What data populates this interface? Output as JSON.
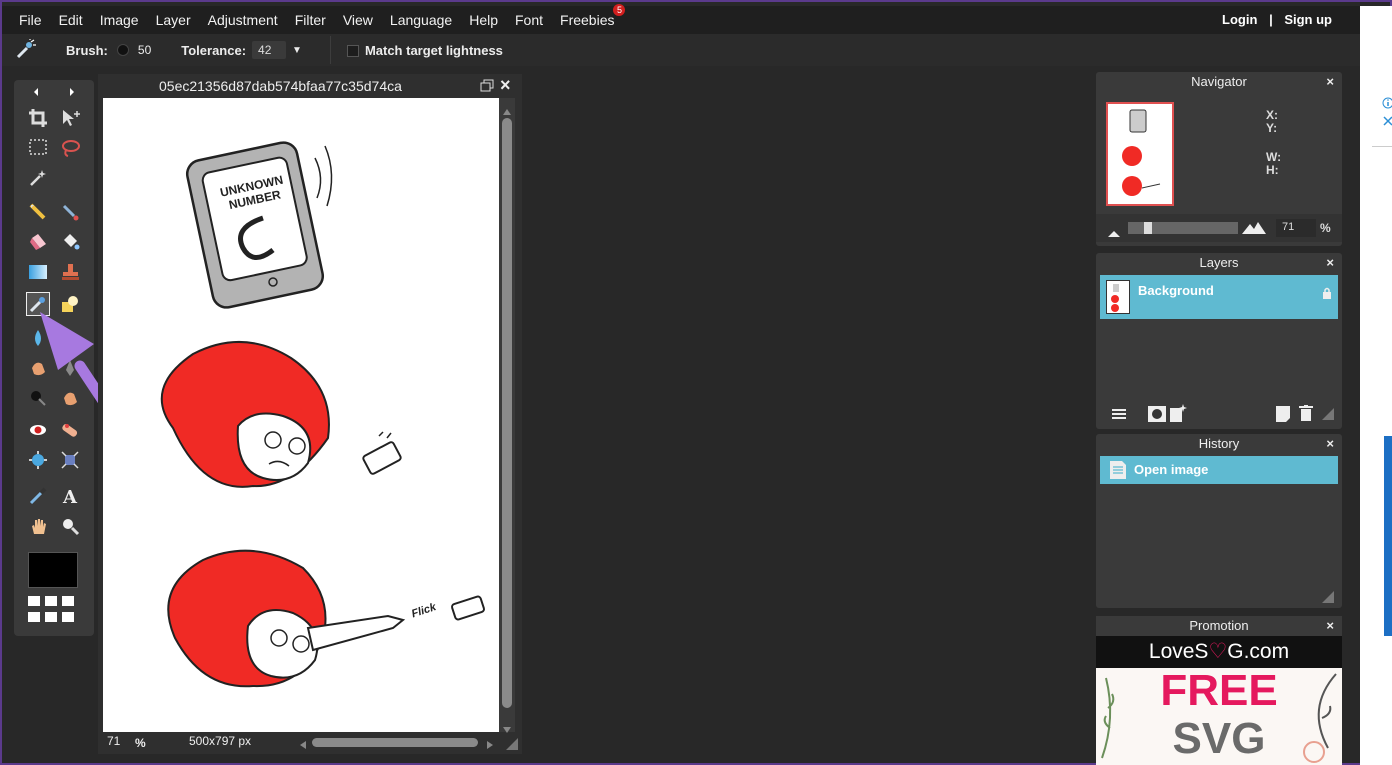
{
  "menu": [
    "File",
    "Edit",
    "Image",
    "Layer",
    "Adjustment",
    "Filter",
    "View",
    "Language",
    "Help",
    "Font",
    "Freebies"
  ],
  "freebies_badge": "5",
  "auth": {
    "login": "Login",
    "sep": "|",
    "signup": "Sign up"
  },
  "options": {
    "brush_label": "Brush:",
    "brush_value": "50",
    "tolerance_label": "Tolerance:",
    "tolerance_value": "42",
    "match_label": "Match target lightness"
  },
  "document": {
    "title": "05ec21356d87dab574bfaa77c35d74ca",
    "zoom": "71",
    "zoom_unit": "%",
    "size": "500x797 px",
    "drawing_text": {
      "line1": "UNKNOWN",
      "line2": "NUMBER",
      "flick": "Flick"
    }
  },
  "navigator": {
    "title": "Navigator",
    "x_label": "X:",
    "y_label": "Y:",
    "w_label": "W:",
    "h_label": "H:",
    "zoom": "71",
    "zoom_unit": "%"
  },
  "layers": {
    "title": "Layers",
    "items": [
      "Background"
    ]
  },
  "history": {
    "title": "History",
    "items": [
      "Open image"
    ]
  },
  "promotion": {
    "title": "Promotion",
    "brand_a": "LoveS",
    "brand_b": "G.com",
    "line1": "FREE",
    "line2": "SVG"
  },
  "close_glyph": "×",
  "colors": {
    "accent": "#5fbad1",
    "arrow": "#a779e0",
    "menubar": "#1f1f1f",
    "workspace": "#282828",
    "panel": "#3a3a3a",
    "hood_red": "#f02a25",
    "promo_pink": "#e5195e"
  }
}
